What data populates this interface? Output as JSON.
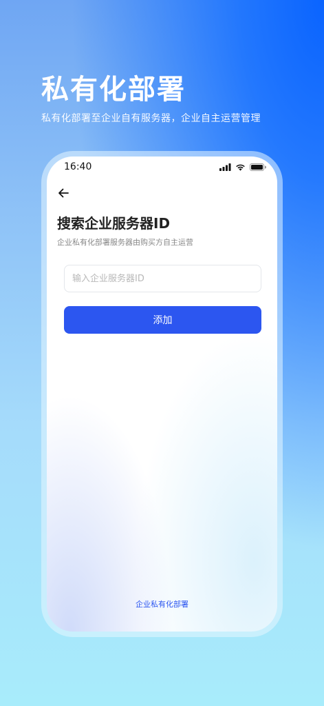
{
  "promo": {
    "title": "私有化部署",
    "subtitle": "私有化部署至企业自有服务器，企业自主运营管理"
  },
  "status_bar": {
    "time": "16:40",
    "icons": [
      "cellular-signal-icon",
      "wifi-icon",
      "battery-icon"
    ]
  },
  "header": {
    "back_icon": "arrow-left-icon"
  },
  "main": {
    "title": "搜索企业服务器ID",
    "subtitle": "企业私有化部署服务器由购买方自主运营",
    "input": {
      "value": "",
      "placeholder": "输入企业服务器ID"
    },
    "add_button_label": "添加"
  },
  "footer": {
    "link_label": "企业私有化部署"
  },
  "colors": {
    "accent": "#2c56f0",
    "background_top": "#0a64ff",
    "background_bottom": "#a8ecfb"
  }
}
